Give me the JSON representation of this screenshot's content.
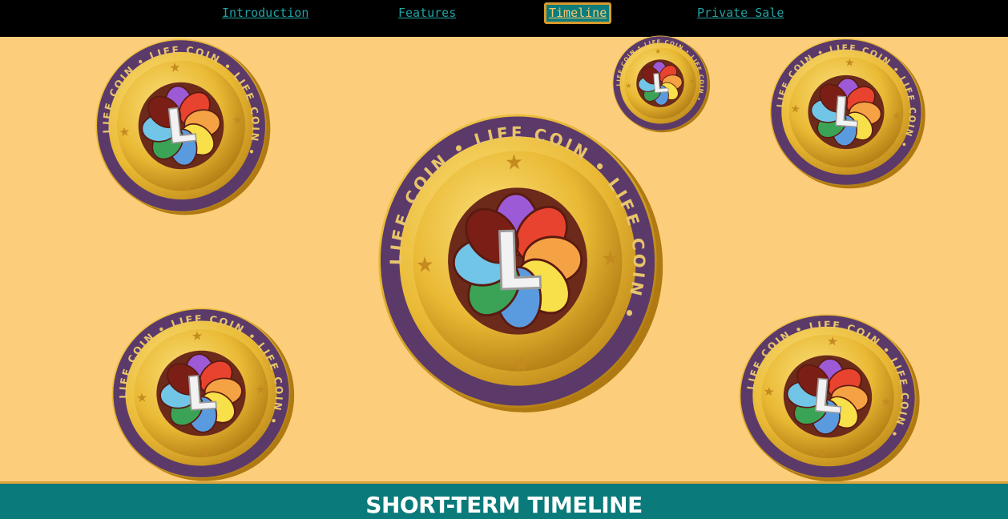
{
  "nav": {
    "items": [
      {
        "label": "Introduction"
      },
      {
        "label": "Features"
      },
      {
        "label": "Timeline",
        "active": true
      },
      {
        "label": "Private Sale"
      }
    ]
  },
  "coins": {
    "ring_text": "LIFE COIN",
    "center_letter": "L",
    "colors": {
      "gold": "#e9b934",
      "gold_dark": "#b07a12",
      "ring": "#5b3a6a",
      "ring_text": "#e8c56a",
      "star": "#c48a1f"
    }
  },
  "section": {
    "title": "SHORT-TERM TIMELINE"
  },
  "colors": {
    "background": "#fccd7a",
    "nav_background": "#000000",
    "nav_link": "#1fa3a3",
    "active_tab_bg": "#0c7c7c",
    "active_tab_border": "#d89a2c",
    "band": "#0a7a7a",
    "band_border": "#d9a33a"
  }
}
